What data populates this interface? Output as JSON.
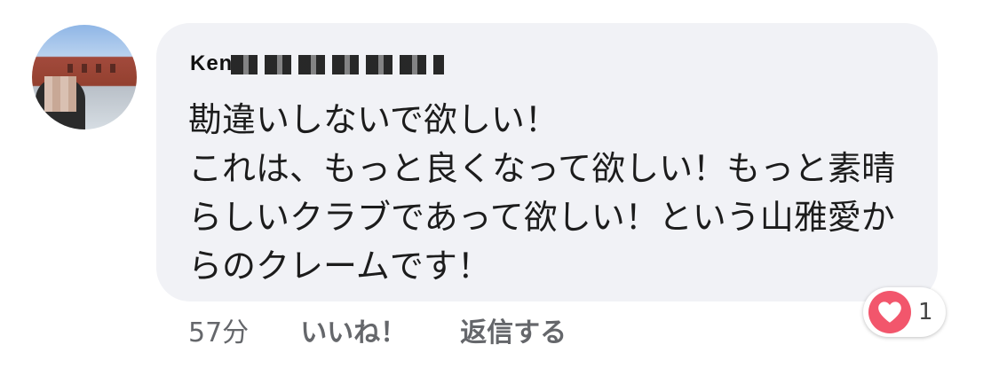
{
  "comment": {
    "author_visible": "Ken",
    "text": "勘違いしないで欲しい！\nこれは、もっと良くなって欲しい！もっと素晴らしいクラブであって欲しい！という山雅愛からのクレームです！",
    "timestamp": "57分",
    "like_label": "いいね！",
    "reply_label": "返信する",
    "reaction_count": "1",
    "reaction_icon": "heart-icon",
    "reaction_color": "#f2566c"
  }
}
